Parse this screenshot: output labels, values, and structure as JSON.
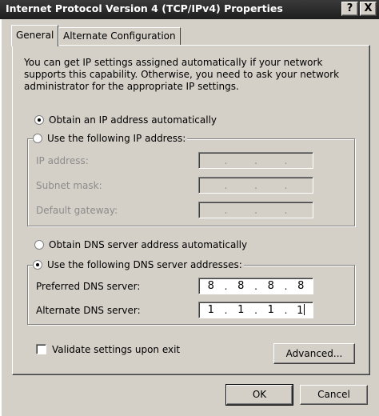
{
  "window": {
    "title": "Internet Protocol Version 4 (TCP/IPv4) Properties",
    "help_glyph": "?",
    "close_glyph": "X"
  },
  "tabs": [
    {
      "label": "General",
      "active": true
    },
    {
      "label": "Alternate Configuration",
      "active": false
    }
  ],
  "general": {
    "intro": "You can get IP settings assigned automatically if your network supports this capability. Otherwise, you need to ask your network administrator for the appropriate IP settings.",
    "ip_mode": {
      "auto_label": "Obtain an IP address automatically",
      "manual_label": "Use the following IP address:",
      "selected": "auto"
    },
    "ip_fields": {
      "ip_label": "IP address:",
      "subnet_label": "Subnet mask:",
      "gateway_label": "Default gateway:"
    },
    "dns_mode": {
      "auto_label": "Obtain DNS server address automatically",
      "manual_label": "Use the following DNS server addresses:",
      "selected": "manual"
    },
    "dns_fields": {
      "preferred_label": "Preferred DNS server:",
      "preferred_value": [
        "8",
        "8",
        "8",
        "8"
      ],
      "alternate_label": "Alternate DNS server:",
      "alternate_value": [
        "1",
        "1",
        "1",
        "1"
      ]
    },
    "validate_label": "Validate settings upon exit",
    "validate_checked": false,
    "advanced_label": "Advanced..."
  },
  "footer": {
    "ok_label": "OK",
    "cancel_label": "Cancel"
  }
}
